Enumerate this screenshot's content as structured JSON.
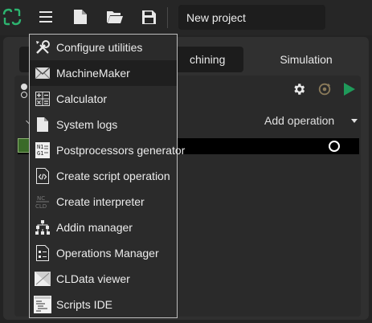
{
  "toolbar": {
    "project_name": "New project",
    "icons": [
      "app-logo-icon",
      "menu-icon",
      "new-file-icon",
      "open-folder-icon",
      "save-icon"
    ]
  },
  "tabs": [
    {
      "label": "chining"
    },
    {
      "label": "Simulation"
    }
  ],
  "operations": {
    "add_operation_label": "Add operation"
  },
  "menu": {
    "items": [
      {
        "label": "Configure utilities",
        "icon": "wrench-screwdriver-icon"
      },
      {
        "label": "MachineMaker",
        "icon": "envelope-icon"
      },
      {
        "label": "Calculator",
        "icon": "calculator-icon"
      },
      {
        "label": "System logs",
        "icon": "document-icon"
      },
      {
        "label": "Postprocessors generator",
        "icon": "nc-code-icon"
      },
      {
        "label": "Create script operation",
        "icon": "code-file-icon"
      },
      {
        "label": "Create interpreter",
        "icon": "nc-cld-icon"
      },
      {
        "label": "Addin manager",
        "icon": "hierarchy-icon"
      },
      {
        "label": "Operations Manager",
        "icon": "list-document-icon"
      },
      {
        "label": "CLData viewer",
        "icon": "cldata-icon"
      },
      {
        "label": "Scripts IDE",
        "icon": "scripts-ide-icon"
      }
    ]
  },
  "colors": {
    "accent_green": "#2db36f",
    "play_green": "#1f9a5a",
    "menu_border": "#bdbdbd"
  }
}
